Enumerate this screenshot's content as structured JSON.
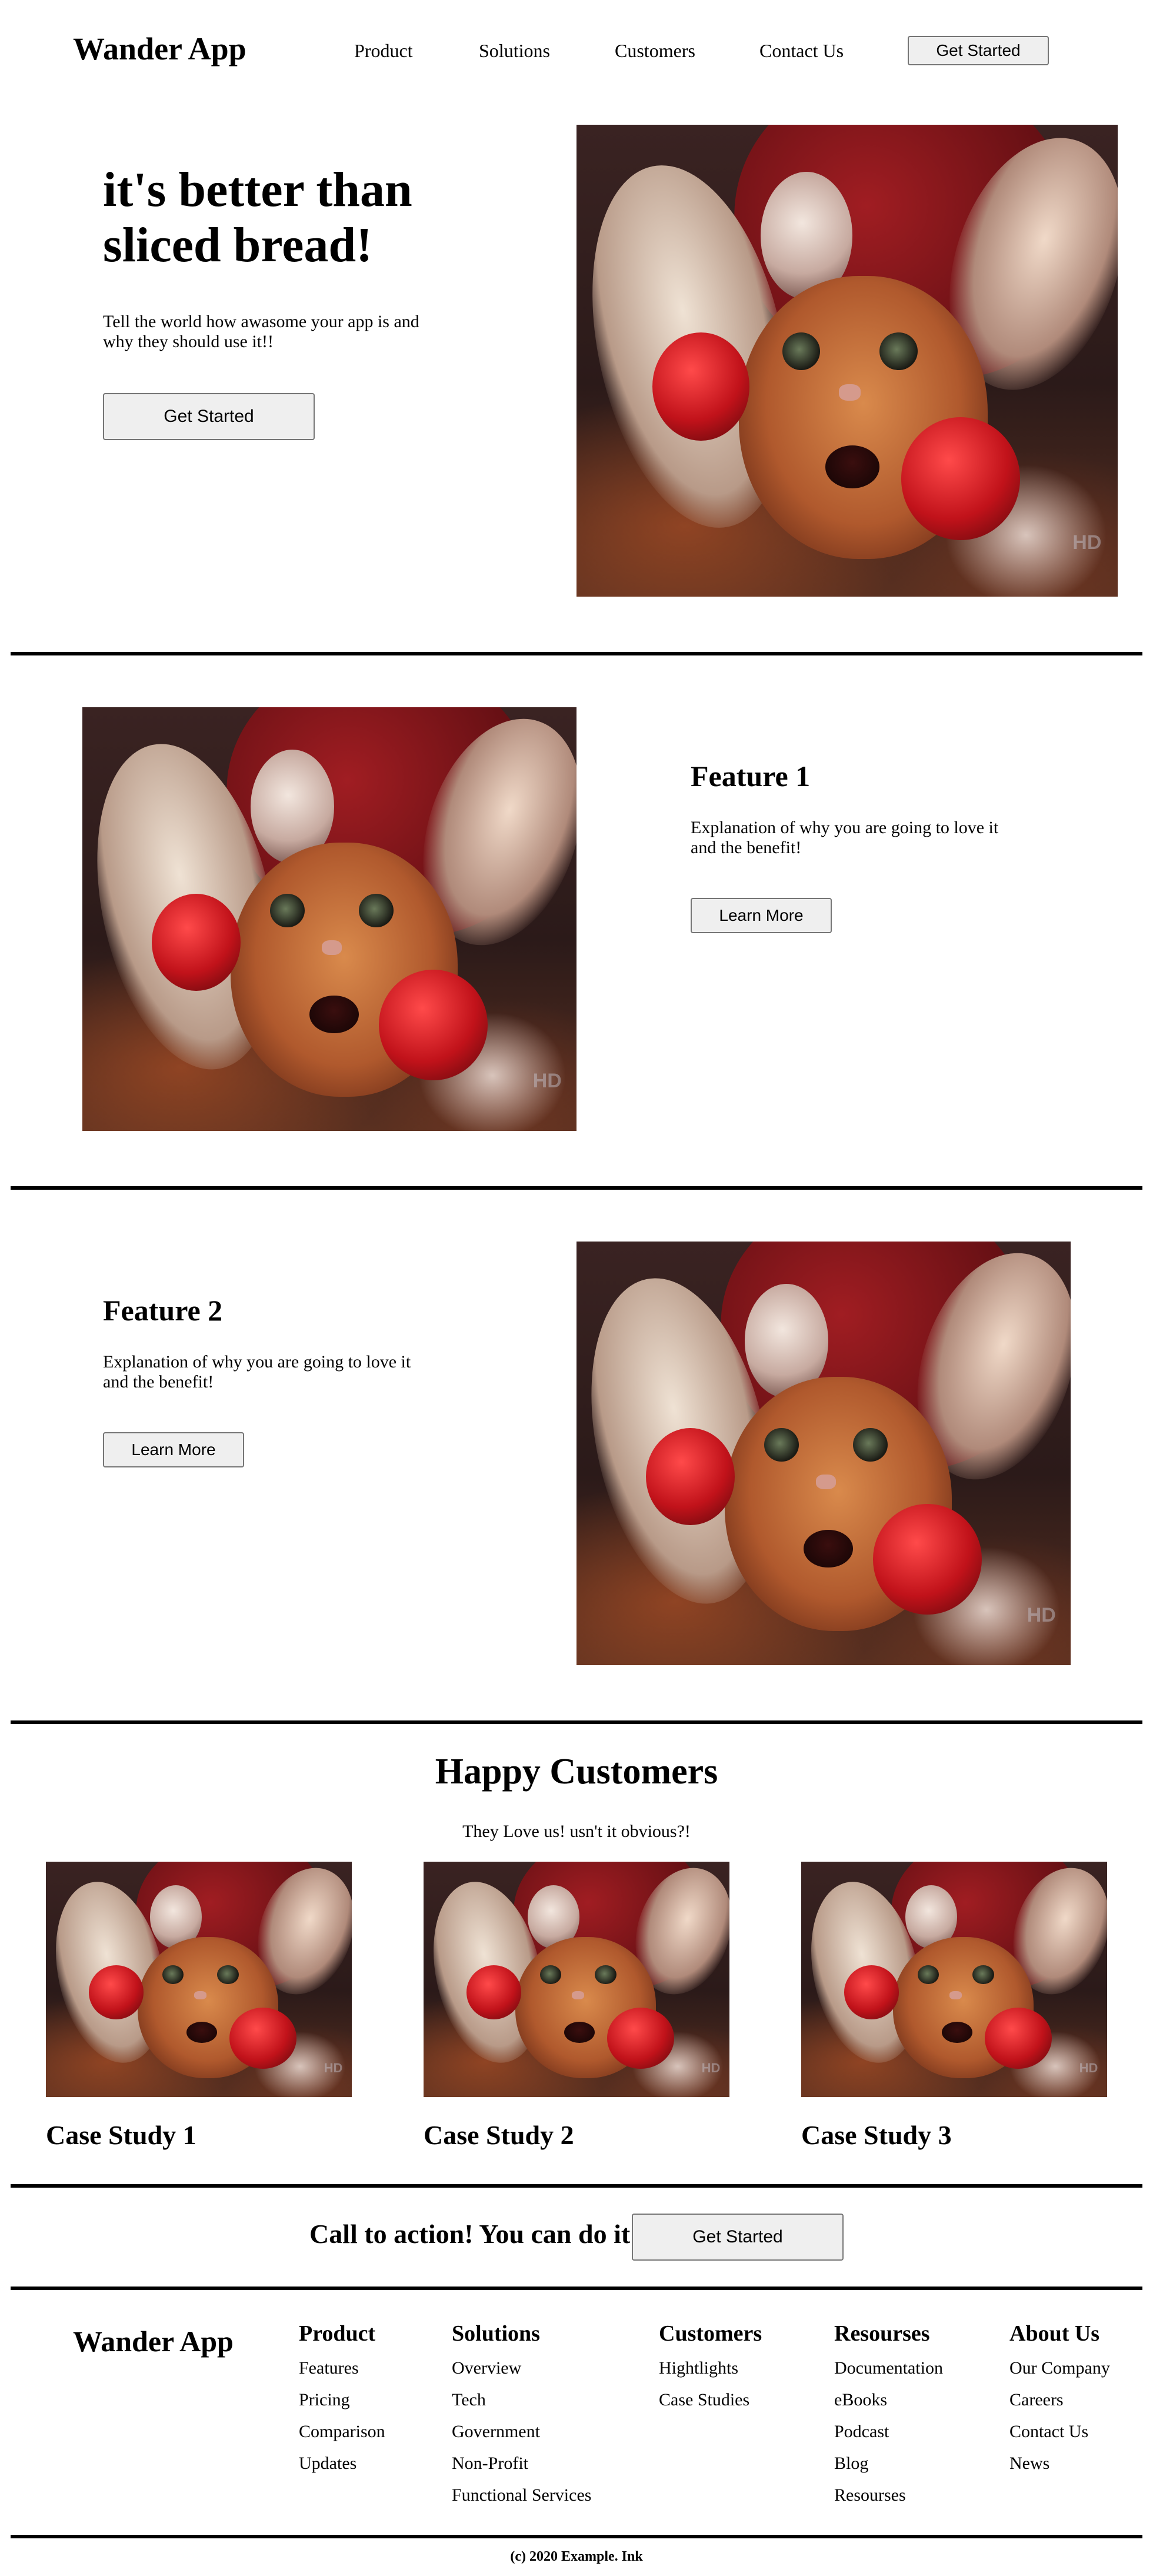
{
  "header": {
    "brand": "Wander App",
    "nav": [
      "Product",
      "Solutions",
      "Customers",
      "Contact Us"
    ],
    "cta_label": "Get Started"
  },
  "hero": {
    "title_line1": "it's better than",
    "title_line2": "sliced bread!",
    "subtitle_line1": "Tell the world how awasome your app is and",
    "subtitle_line2": "why they should use it!!",
    "cta_label": "Get Started",
    "image_watermark": "HD"
  },
  "feature1": {
    "title": "Feature 1",
    "text_line1": "Explanation of why you are going to love it",
    "text_line2": "and the benefit!",
    "button_label": "Learn More"
  },
  "feature2": {
    "title": "Feature 2",
    "text_line1": "Explanation of why you are going to love it",
    "text_line2": "and the benefit!",
    "button_label": "Learn More"
  },
  "customers": {
    "title": "Happy Customers",
    "subtitle": "They Love us! usn't it obvious?!",
    "case_studies": [
      "Case Study 1",
      "Case Study 2",
      "Case Study 3"
    ]
  },
  "cta": {
    "text": "Call to action! You can do it!",
    "button_label": "Get Started"
  },
  "footer": {
    "brand": "Wander App",
    "columns": [
      {
        "title": "Product",
        "links": [
          "Features",
          "Pricing",
          "Comparison",
          "Updates"
        ]
      },
      {
        "title": "Solutions",
        "links": [
          "Overview",
          "Tech",
          "Government",
          "Non-Profit",
          "Functional Services"
        ]
      },
      {
        "title": "Customers",
        "links": [
          "Hightlights",
          "Case Studies"
        ]
      },
      {
        "title": "Resourses",
        "links": [
          "Documentation",
          "eBooks",
          "Podcast",
          "Blog",
          "Resourses"
        ]
      },
      {
        "title": "About Us",
        "links": [
          "Our Company",
          "Careers",
          "Contact Us",
          "News"
        ]
      }
    ],
    "copyright": "(c) 2020 Example. Ink"
  }
}
